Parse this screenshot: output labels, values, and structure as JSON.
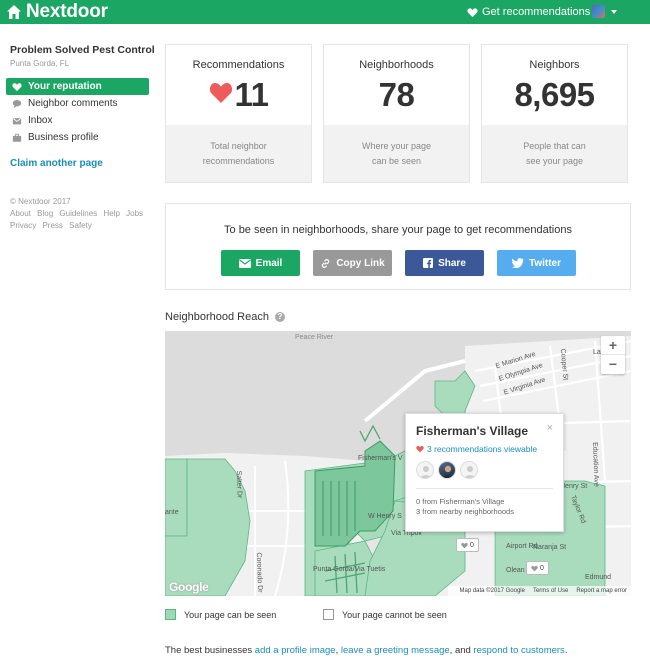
{
  "header": {
    "brand": "Nextdoor",
    "get_recommendations": "Get recommendations",
    "colors": {
      "brand_green": "#1ca664",
      "link_blue": "#1b8db7",
      "heart_red": "#ee5b5b"
    }
  },
  "sidebar": {
    "business_name": "Problem Solved Pest Control",
    "location": "Punta Gorda, FL",
    "items": [
      {
        "label": "Your reputation",
        "icon": "heart-icon",
        "active": true
      },
      {
        "label": "Neighbor comments",
        "icon": "comment-icon",
        "active": false
      },
      {
        "label": "Inbox",
        "icon": "inbox-icon",
        "active": false
      },
      {
        "label": "Business profile",
        "icon": "briefcase-icon",
        "active": false
      }
    ],
    "claim_link": "Claim another page",
    "copyright": "© Nextdoor 2017",
    "footer_links": [
      "About",
      "Blog",
      "Guidelines",
      "Help",
      "Jobs",
      "Privacy",
      "Press",
      "Safety"
    ]
  },
  "stats": [
    {
      "label": "Recommendations",
      "value": "11",
      "caption_1": "Total neighbor",
      "caption_2": "recommendations"
    },
    {
      "label": "Neighborhoods",
      "value": "78",
      "caption_1": "Where your page",
      "caption_2": "can be seen"
    },
    {
      "label": "Neighbors",
      "value": "8,695",
      "caption_1": "People that can",
      "caption_2": "see your page"
    }
  ],
  "share": {
    "title": "To be seen in neighborhoods, share your page to get recommendations",
    "buttons": [
      {
        "label": "Email",
        "icon": "envelope-icon",
        "color": "#1ca664"
      },
      {
        "label": "Copy Link",
        "icon": "link-icon",
        "color": "#999999"
      },
      {
        "label": "Share",
        "icon": "facebook-icon",
        "color": "#3b5998"
      },
      {
        "label": "Twitter",
        "icon": "twitter-icon",
        "color": "#55acee"
      }
    ]
  },
  "reach": {
    "title": "Neighborhood Reach",
    "help": "?",
    "map": {
      "labels": {
        "peace_river": "Peace River",
        "marion": "E Marion Ave",
        "olympia": "E Olympia Ave",
        "virginia": "E Virginia Ave",
        "cooper": "Cooper St",
        "fishermans": "Fisherman's V",
        "henry": "W Henry S",
        "henry_e": "Henry St",
        "tripoli": "Via Tripoli",
        "punta": "Punta Gorda/Via Tuetis",
        "naranja": "Naranja St",
        "education": "Education Ave",
        "taylor": "Taylor Rd",
        "coronado": "Coronado Dr",
        "salter": "Salter Dr",
        "ante": "ante",
        "edmund": "Edmund",
        "airport": "Airport Rd",
        "olean": "Olean",
        "laplata": "La Pl"
      },
      "zoom_in": "+",
      "zoom_out": "−",
      "pins": [
        "0",
        "0",
        "0"
      ],
      "google": "Google",
      "attribution": {
        "data": "Map data ©2017 Google",
        "terms": "Terms of Use",
        "report": "Report a map error"
      },
      "popup": {
        "title": "Fisherman's Village",
        "close": "×",
        "recommendations": "3 recommendations viewable",
        "from_here": "0 from Fisherman's Village",
        "from_nearby": "3 from nearby neighborhoods"
      }
    },
    "legend": {
      "seen": "Your page can be seen",
      "not_seen": "Your page cannot be seen",
      "seen_color": "#9fd8b6",
      "not_seen_color": "#ffffff"
    }
  },
  "bottom": {
    "prefix": "The best businesses ",
    "link1": "add a profile image",
    "sep1": ", ",
    "link2": "leave a greeting message",
    "sep2": ", and ",
    "link3": "respond to customers",
    "suffix": "."
  }
}
